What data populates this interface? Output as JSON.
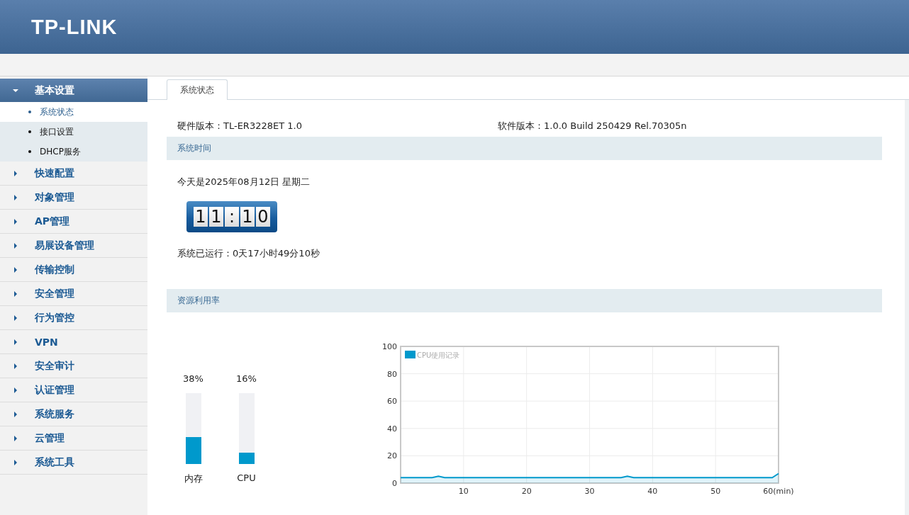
{
  "header": {
    "logo": "TP-LINK"
  },
  "sidebar": {
    "groups": [
      {
        "label": "基本设置",
        "expanded": true,
        "children": [
          {
            "label": "系统状态",
            "selected": true
          },
          {
            "label": "接口设置",
            "selected": false
          },
          {
            "label": "DHCP服务",
            "selected": false
          }
        ]
      },
      {
        "label": "快速配置",
        "expanded": false
      },
      {
        "label": "对象管理",
        "expanded": false
      },
      {
        "label": "AP管理",
        "expanded": false
      },
      {
        "label": "易展设备管理",
        "expanded": false
      },
      {
        "label": "传输控制",
        "expanded": false
      },
      {
        "label": "安全管理",
        "expanded": false
      },
      {
        "label": "行为管控",
        "expanded": false
      },
      {
        "label": "VPN",
        "expanded": false
      },
      {
        "label": "安全审计",
        "expanded": false
      },
      {
        "label": "认证管理",
        "expanded": false
      },
      {
        "label": "系统服务",
        "expanded": false
      },
      {
        "label": "云管理",
        "expanded": false
      },
      {
        "label": "系统工具",
        "expanded": false
      }
    ]
  },
  "tabs": [
    {
      "label": "系统状态",
      "selected": true
    }
  ],
  "info": {
    "hardware": "硬件版本：TL-ER3228ET 1.0",
    "software": "软件版本：1.0.0 Build 250429 Rel.70305n"
  },
  "time_section": {
    "title": "系统时间",
    "date": "今天是2025年08月12日 星期二",
    "clock_digits": [
      "1",
      "1",
      ":",
      "1",
      "0"
    ],
    "uptime": "系统已运行：0天17小时49分10秒"
  },
  "resources": {
    "title": "资源利用率",
    "meters": [
      {
        "label": "内存",
        "reading": "38%",
        "level": 0.38
      },
      {
        "label": "CPU",
        "reading": "16%",
        "level": 0.16
      }
    ],
    "chart_data": {
      "type": "area",
      "grid": true,
      "xlim": [
        0,
        60
      ],
      "ylim": [
        0,
        100
      ],
      "yticks": [
        0,
        20,
        40,
        60,
        80,
        100
      ],
      "xticks": [
        10,
        20,
        30,
        40,
        50,
        {
          "value": 60,
          "label": "60(min)"
        }
      ],
      "x": [
        0,
        1,
        2,
        3,
        4,
        5,
        6,
        7,
        8,
        9,
        10,
        11,
        12,
        13,
        14,
        15,
        16,
        17,
        18,
        19,
        20,
        21,
        22,
        23,
        24,
        25,
        26,
        27,
        28,
        29,
        30,
        31,
        32,
        33,
        34,
        35,
        36,
        37,
        38,
        39,
        40,
        41,
        42,
        43,
        44,
        45,
        46,
        47,
        48,
        49,
        50,
        51,
        52,
        53,
        54,
        55,
        56,
        57,
        58,
        59,
        60
      ],
      "series": [
        {
          "name": "CPU使用记录",
          "color": "#0099cc",
          "values": [
            4,
            4,
            4,
            4,
            4,
            4,
            5,
            4,
            4,
            4,
            4,
            4,
            4,
            4,
            4,
            4,
            4,
            4,
            4,
            4,
            4,
            4,
            4,
            4,
            4,
            4,
            4,
            4,
            4,
            4,
            4,
            4,
            4,
            4,
            4,
            4,
            5,
            4,
            4,
            4,
            4,
            4,
            4,
            4,
            4,
            4,
            4,
            4,
            4,
            4,
            4,
            4,
            4,
            4,
            4,
            4,
            4,
            4,
            4,
            4,
            7
          ]
        }
      ]
    }
  }
}
